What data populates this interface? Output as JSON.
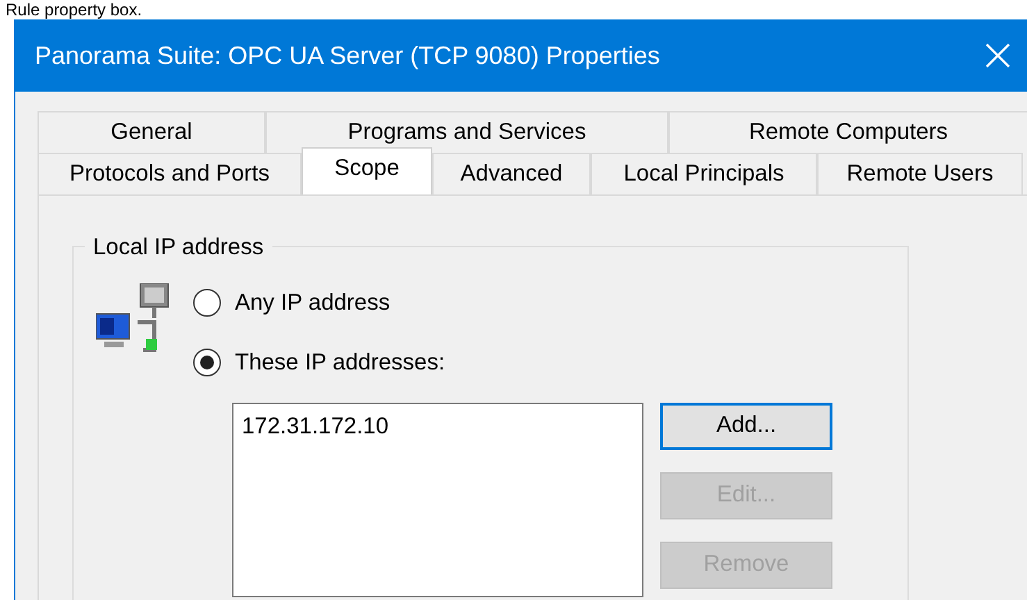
{
  "caption": "Rule property box.",
  "window": {
    "title": "Panorama Suite: OPC UA Server (TCP 9080) Properties"
  },
  "tab_rows": [
    [
      {
        "label": "General",
        "selected": false
      },
      {
        "label": "Programs and Services",
        "selected": false
      },
      {
        "label": "Remote Computers",
        "selected": false
      }
    ],
    [
      {
        "label": "Protocols and Ports",
        "selected": false
      },
      {
        "label": "Scope",
        "selected": true
      },
      {
        "label": "Advanced",
        "selected": false
      },
      {
        "label": "Local Principals",
        "selected": false
      },
      {
        "label": "Remote Users",
        "selected": false
      }
    ]
  ],
  "local_ip": {
    "title": "Local IP address",
    "options": [
      {
        "label": "Any IP address",
        "selected": false
      },
      {
        "label": "These IP addresses:",
        "selected": true
      }
    ],
    "addresses": [
      "172.31.172.10"
    ],
    "buttons": [
      {
        "label": "Add...",
        "disabled": false,
        "focused": true
      },
      {
        "label": "Edit...",
        "disabled": true,
        "focused": false
      },
      {
        "label": "Remove",
        "disabled": true,
        "focused": false
      }
    ]
  }
}
